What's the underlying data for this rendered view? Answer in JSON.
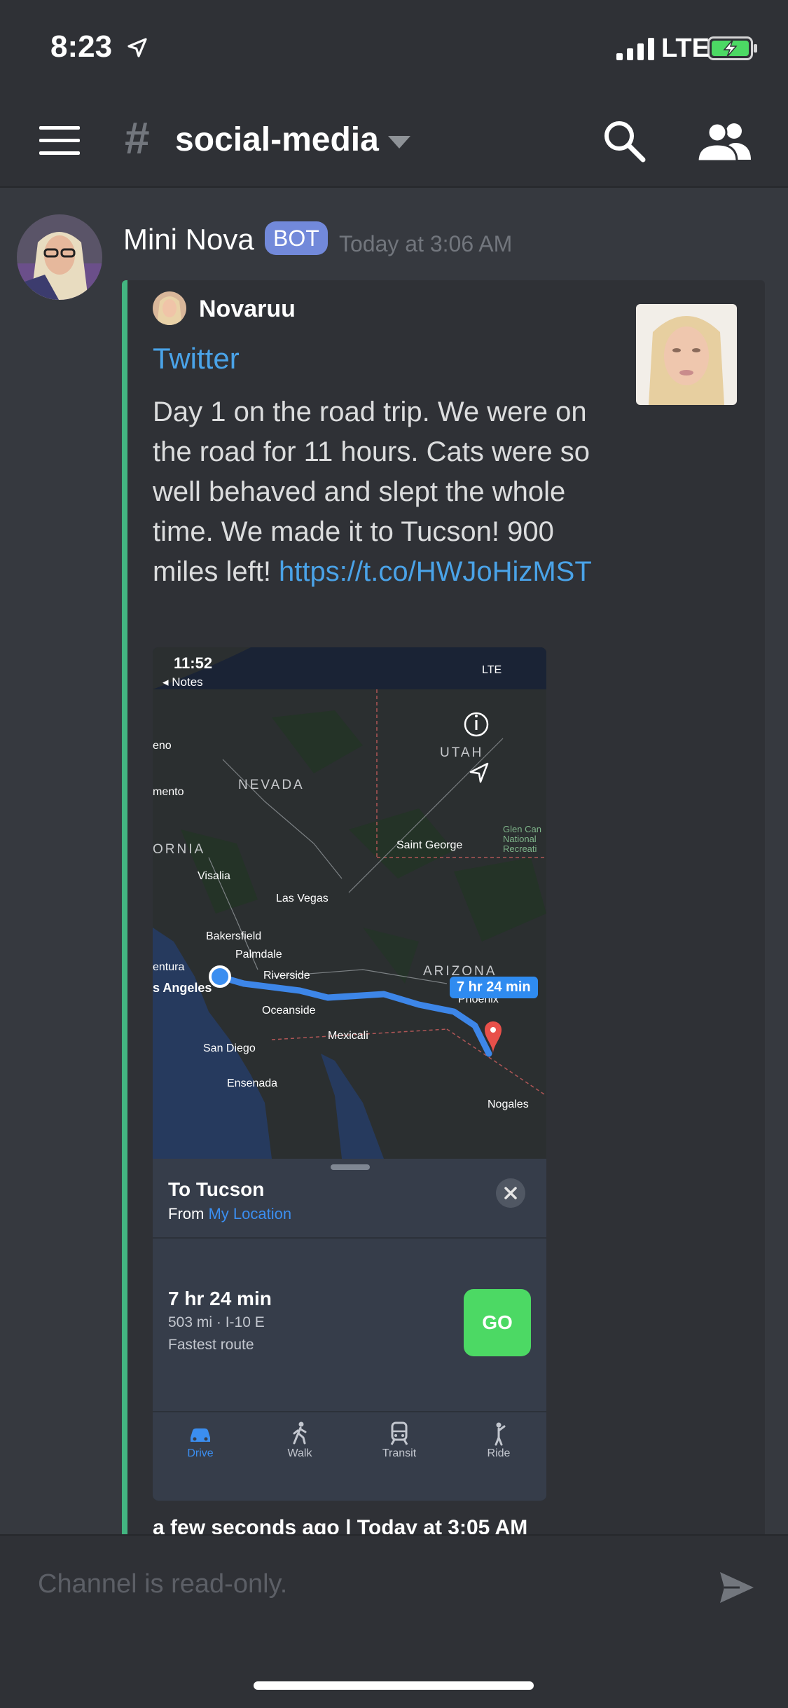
{
  "status_bar": {
    "time": "8:23",
    "network": "LTE"
  },
  "header": {
    "channel_hash": "#",
    "channel_name": "social-media"
  },
  "message": {
    "username": "Mini Nova",
    "badge": "BOT",
    "timestamp": "Today at 3:06 AM",
    "embed": {
      "author": "Novaruu",
      "title": "Twitter",
      "description": "Day 1 on the road trip. We were on the road for 11 hours. Cats were so well behaved and slept the whole time. We made it to Tucson! 900 miles left! ",
      "link": "https://t.co/HWJoHizMST",
      "footer": "a few seconds ago | Today at 3:05 AM",
      "accent_color": "#43b581",
      "screenshot": {
        "status_time": "11:52",
        "back_label": "◂ Notes",
        "network": "LTE",
        "map_labels": {
          "nevada": "NEVADA",
          "utah": "UTAH",
          "arizona": "ARIZONA",
          "california_partial": "ORNIA",
          "reno_partial": "eno",
          "sacramento_partial": "mento",
          "saint_george": "Saint George",
          "glen_canyon": "Glen Can",
          "national": "National",
          "recreation": "Recreati",
          "visalia": "Visalia",
          "las_vegas": "Las Vegas",
          "bakersfield": "Bakersfield",
          "palmdale": "Palmdale",
          "ventura_partial": "entura",
          "los_angeles_partial": "s Angeles",
          "riverside": "Riverside",
          "oceanside": "Oceanside",
          "san_diego": "San Diego",
          "mexicali": "Mexicali",
          "ensenada": "Ensenada",
          "phoenix": "Phoenix",
          "nogales": "Nogales"
        },
        "route_badge": "7 hr 24 min",
        "destination": "To Tucson",
        "from_prefix": "From ",
        "from_location": "My Location",
        "eta": "7 hr 24 min",
        "distance": "503 mi · I-10 E",
        "route_type": "Fastest route",
        "go_label": "GO",
        "tabs": [
          {
            "label": "Drive",
            "icon": "car-icon",
            "active": true
          },
          {
            "label": "Walk",
            "icon": "walk-icon",
            "active": false
          },
          {
            "label": "Transit",
            "icon": "transit-icon",
            "active": false
          },
          {
            "label": "Ride",
            "icon": "ride-icon",
            "active": false
          }
        ]
      }
    }
  },
  "input": {
    "placeholder": "Channel is read-only."
  },
  "colors": {
    "background": "#36393f",
    "header": "#2f3136",
    "link": "#4aa3e8",
    "bot_badge": "#7289da",
    "route": "#2f8bf0",
    "go_button": "#4cd964"
  }
}
